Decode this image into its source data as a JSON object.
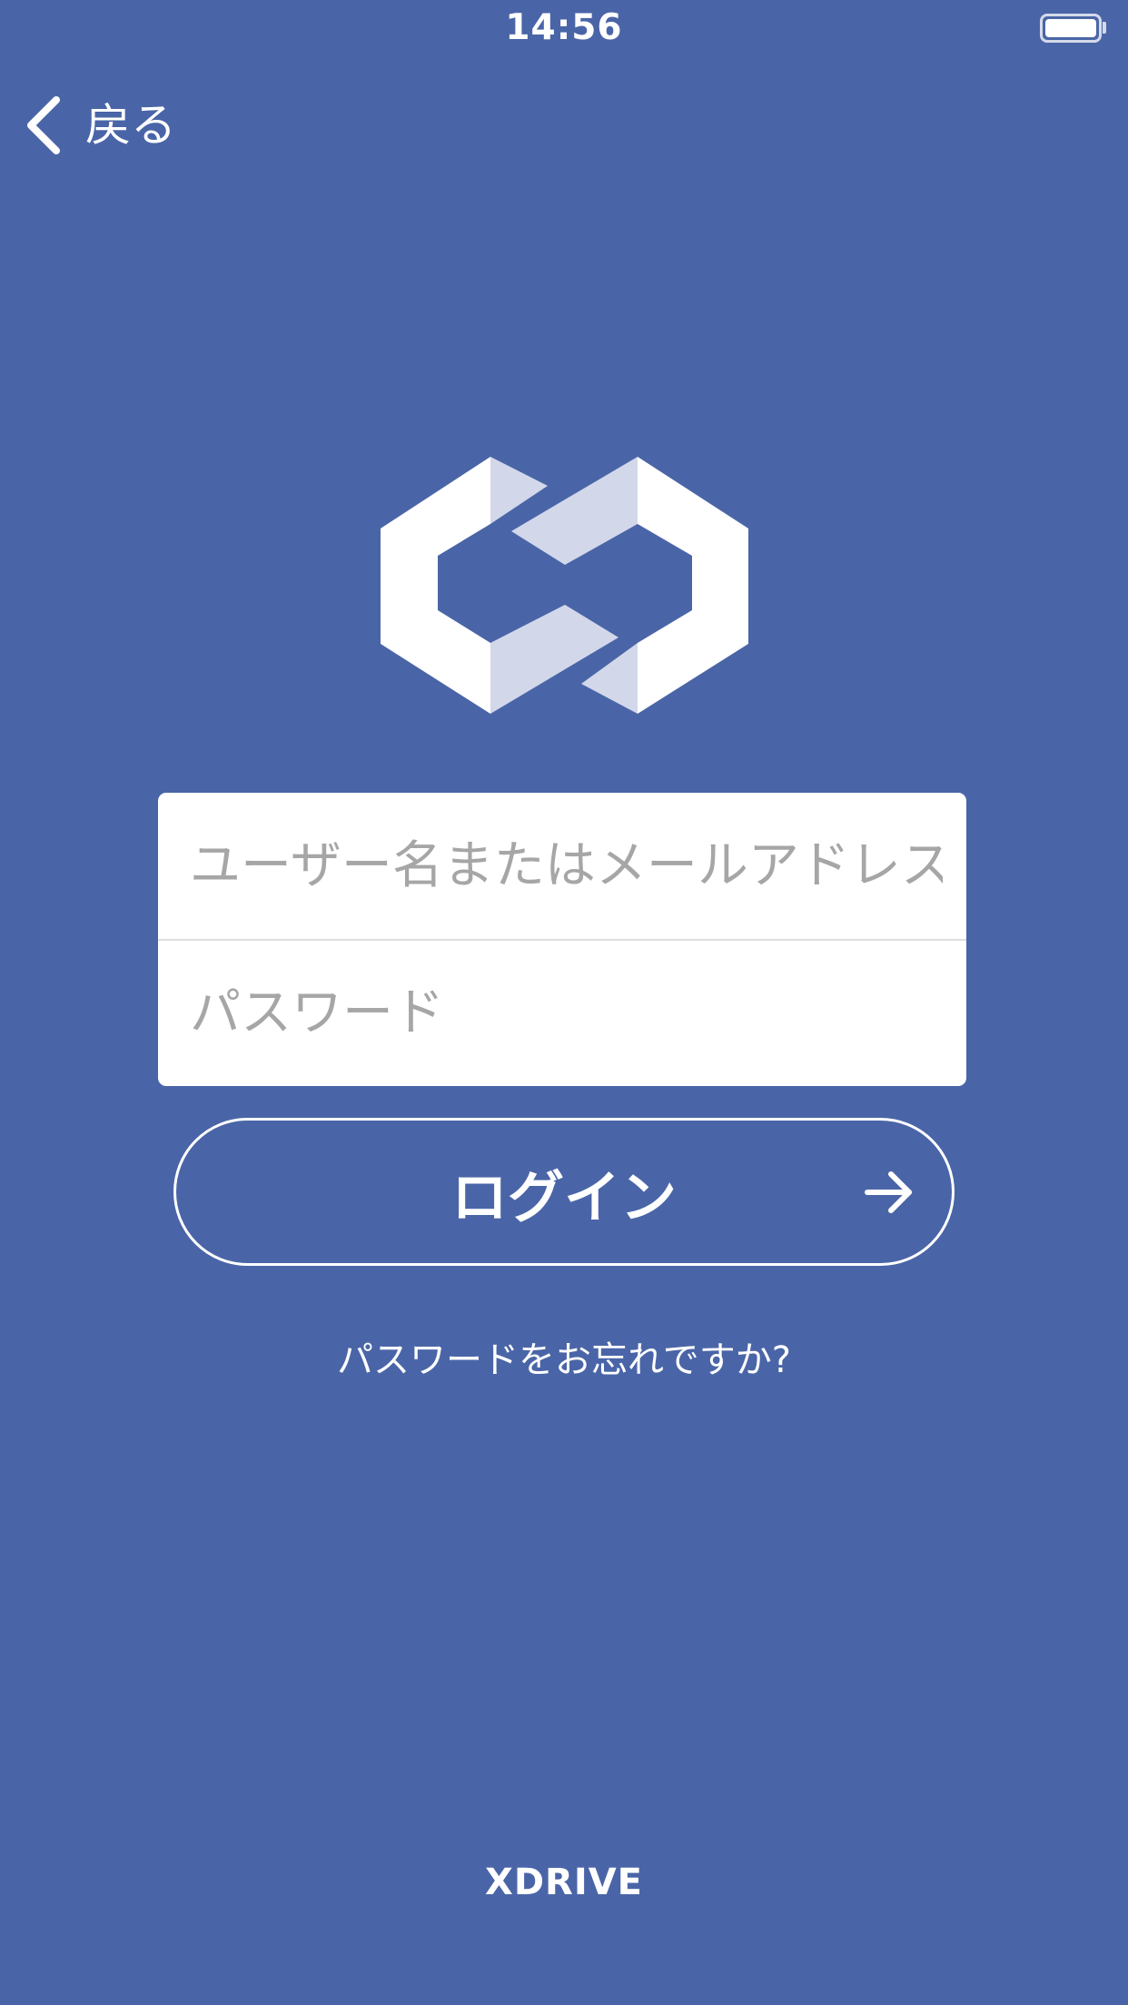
{
  "status_bar": {
    "time": "14:56"
  },
  "nav": {
    "back_label": "戻る"
  },
  "login_form": {
    "username_placeholder": "ユーザー名またはメールアドレス",
    "password_placeholder": "パスワード"
  },
  "actions": {
    "login_label": "ログイン",
    "forgot_password": "パスワードをお忘れですか?"
  },
  "footer": {
    "brand": "XDRIVE"
  },
  "icons": {
    "back": "chevron-left-icon",
    "login_arrow": "arrow-right-icon",
    "logo": "xdrive-logo"
  },
  "colors": {
    "background": "#4a65a7",
    "logo_light": "#ffffff",
    "logo_shade": "#d2d8ea"
  }
}
